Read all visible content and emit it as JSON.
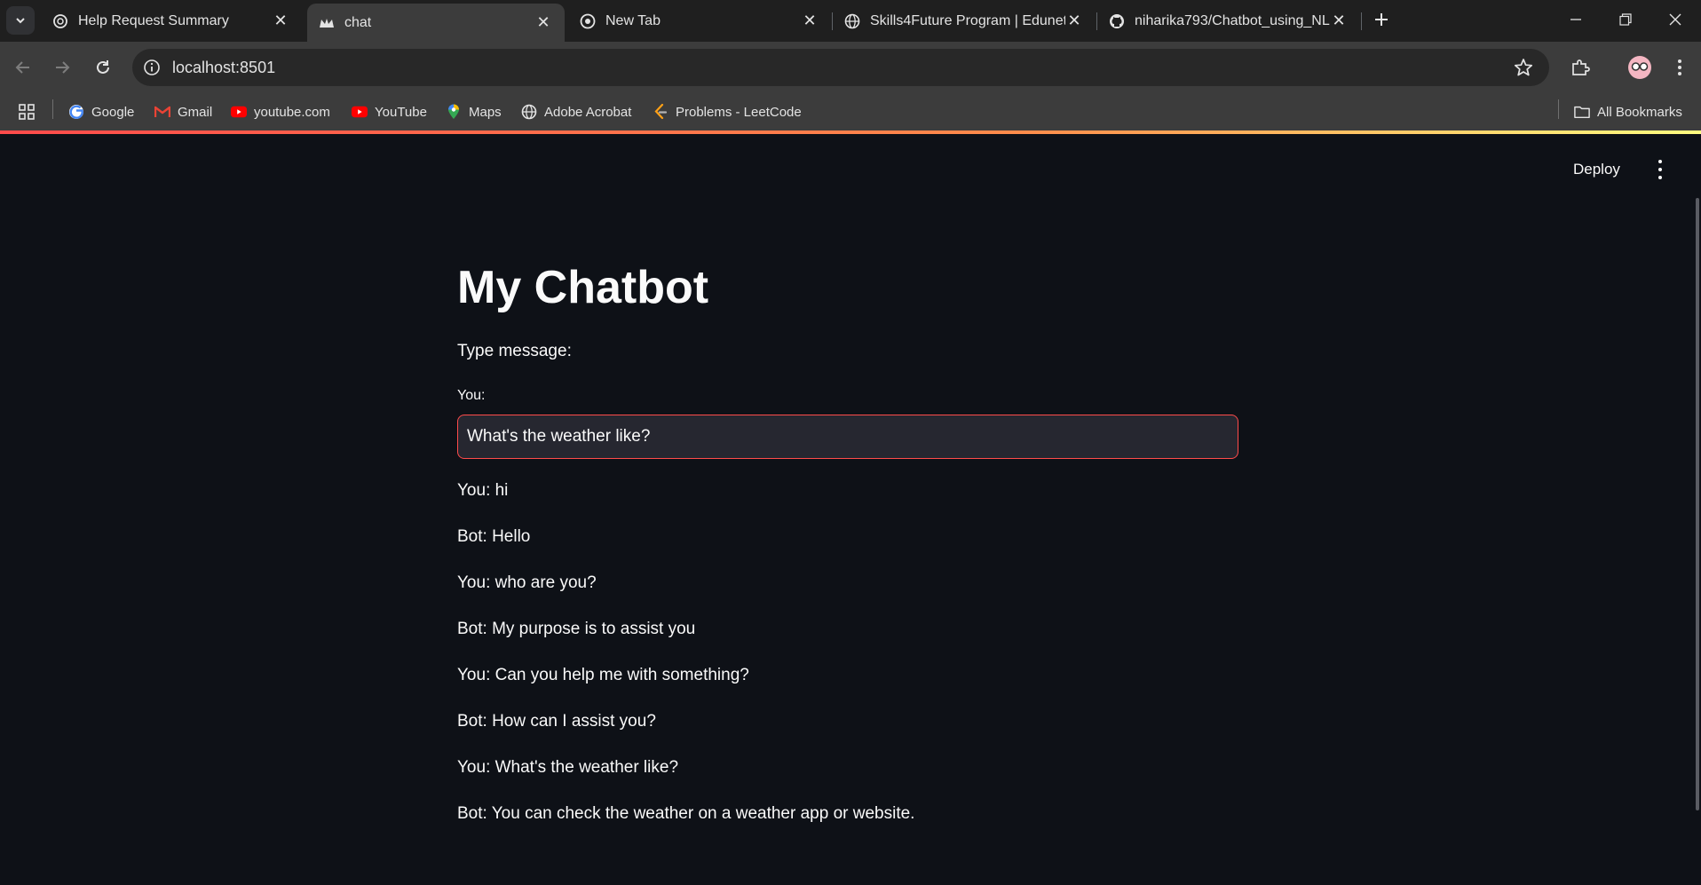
{
  "tabs": [
    {
      "title": "Help Request Summary",
      "icon": "openai-icon",
      "active": false
    },
    {
      "title": "chat",
      "icon": "streamlit-crown-icon",
      "active": true
    },
    {
      "title": "New Tab",
      "icon": "chrome-icon",
      "active": false
    },
    {
      "title": "Skills4Future Program | Edunet",
      "icon": "globe-icon",
      "active": false
    },
    {
      "title": "niharika793/Chatbot_using_NLP",
      "icon": "github-icon",
      "active": false
    }
  ],
  "address_bar": {
    "url": "localhost:8501"
  },
  "bookmarks": [
    {
      "label": "Google",
      "icon": "google-icon"
    },
    {
      "label": "Gmail",
      "icon": "gmail-icon"
    },
    {
      "label": "youtube.com",
      "icon": "youtube-icon"
    },
    {
      "label": "YouTube",
      "icon": "youtube-icon"
    },
    {
      "label": "Maps",
      "icon": "maps-icon"
    },
    {
      "label": "Adobe Acrobat",
      "icon": "globe-icon"
    },
    {
      "label": "Problems - LeetCode",
      "icon": "leetcode-icon"
    }
  ],
  "all_bookmarks": "All Bookmarks",
  "app": {
    "deploy_label": "Deploy",
    "title": "My Chatbot",
    "prompt": "Type message:",
    "input_label": "You:",
    "input_value": "What's the weather like?",
    "messages": [
      "You: hi",
      "Bot: Hello",
      "You: who are you?",
      "Bot: My purpose is to assist you",
      "You: Can you help me with something?",
      "Bot: How can I assist you?",
      "You: What's the weather like?",
      "Bot: You can check the weather on a weather app or website."
    ]
  },
  "colors": {
    "background": "#0e1117",
    "text": "#fafafa",
    "accent": "#ff4b4b",
    "input_bg": "#262730"
  }
}
